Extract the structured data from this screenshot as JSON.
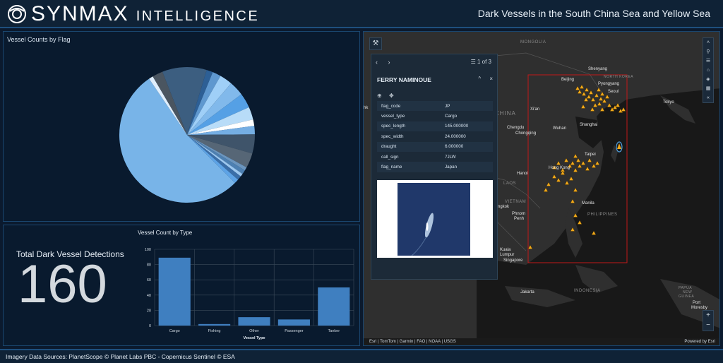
{
  "header": {
    "brand_main": "SYNMAX",
    "brand_sub": "INTELLIGENCE",
    "title": "Dark Vessels in the South China Sea and Yellow Sea"
  },
  "pie_panel": {
    "title": "Vessel Counts by Flag"
  },
  "pie_chart": {
    "chart_data": {
      "type": "pie",
      "values": [
        52.5,
        1.0,
        2.5,
        10.5,
        1.5,
        2.0,
        3.0,
        3.5,
        3.5,
        3.0,
        1.5,
        2.0,
        4.5,
        3.5,
        0.8,
        1.0,
        0.7,
        1.0,
        1.0
      ],
      "colors": [
        "#78b4e8",
        "#dfeefc",
        "#4a5560",
        "#3c5e80",
        "#2d5f95",
        "#5f98cf",
        "#9fcff7",
        "#81b9eb",
        "#55a0e5",
        "#b8dcf8",
        "#ffffff",
        "#75aee3",
        "#3f546a",
        "#566676",
        "#6b95be",
        "#4d80b2",
        "#9cc7ef",
        "#3a6ea8",
        "#5da3e6"
      ]
    }
  },
  "kpi": {
    "title": "Total Dark Vessel Detections",
    "value": "160"
  },
  "bar_chart": {
    "chart_data": {
      "type": "bar",
      "title": "Vessel Count by Type",
      "xlabel": "Vessel Type",
      "ylabel": "",
      "categories": [
        "Cargo",
        "Fishing",
        "Other",
        "Passenger",
        "Tanker"
      ],
      "values": [
        89,
        2,
        11,
        8,
        50
      ],
      "ylim": [
        0,
        100
      ],
      "yticks": [
        "0",
        "20",
        "40",
        "60",
        "80",
        "100"
      ],
      "bar_color": "#3f7fc0"
    }
  },
  "map": {
    "tool_icon": "wrench-icon",
    "widgets": [
      "search-icon",
      "list-icon",
      "home-icon",
      "layers-icon",
      "qr-icon",
      "collapse-icon"
    ],
    "zoom_in": "+",
    "zoom_out": "−",
    "attribution_left": "Esri | TomTom | Garmin | FAO | NOAA | USGS",
    "attribution_right": "Powered by Esri",
    "labels": {
      "mongolia": "MONGOLIA",
      "china": "CHINA",
      "xian": "Xi'an",
      "chengdu": "Chengdu",
      "chongqing": "Chongqing",
      "wuhan": "Wuhan",
      "shanghai": "Shanghai",
      "shenyang": "Shenyang",
      "beijing": "Beijing",
      "north_korea": "NORTH KOREA",
      "pyongyang": "Pyongyang",
      "seoul": "Seoul",
      "tokyo": "Tokyo",
      "taipei": "Taipei",
      "hongkong": "Hong Kong",
      "hanoi": "Hanoi",
      "laos": "LAOS",
      "vietnam": "VIETNAM",
      "bangkok": "ngkok",
      "phnom_penh_1": "Phnom",
      "phnom_penh_2": "Penh",
      "manila": "Manila",
      "philippines": "PHILIPPINES",
      "kuala_1": "Kuala",
      "kuala_2": "Lumpur",
      "singapore": "Singapore",
      "jakarta": "Jakarta",
      "indonesia": "INDONESIA",
      "papua_1": "PAPUA",
      "papua_2": "NEW",
      "papua_3": "GUINEA",
      "port_moresby_1": "Port",
      "port_moresby_2": "Moresby",
      "left_edge": "hk"
    },
    "popup": {
      "nav_prev": "‹",
      "nav_next": "›",
      "pager": "1 of 3",
      "title": "FERRY NAMINOUE",
      "collapse_icon": "^",
      "close_icon": "×",
      "rows": [
        {
          "key": "flag_code",
          "value": "JP"
        },
        {
          "key": "vessel_type",
          "value": "Cargo"
        },
        {
          "key": "spec_length",
          "value": "145.000000"
        },
        {
          "key": "spec_width",
          "value": "24.000000"
        },
        {
          "key": "draught",
          "value": "6.000000"
        },
        {
          "key": "call_sign",
          "value": "7JLW"
        },
        {
          "key": "flag_name",
          "value": "Japan"
        }
      ]
    }
  },
  "footer": {
    "text": "Imagery Data Sources: PlanetScope © Planet Labs PBC - Copernicus Sentinel © ESA"
  }
}
